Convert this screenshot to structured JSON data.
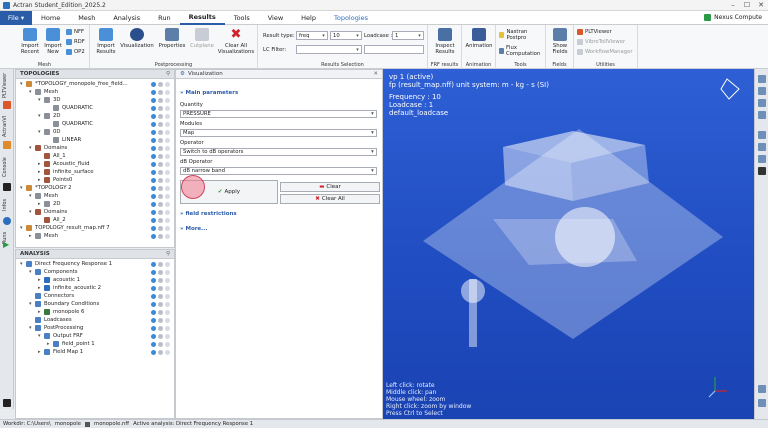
{
  "window": {
    "title": "Actran Student_Edition_2025.2"
  },
  "menu": {
    "file": "File",
    "items": [
      "Home",
      "Mesh",
      "Analysis",
      "Run",
      "Results",
      "Tools",
      "View",
      "Help",
      "Topologies"
    ],
    "active": "Results",
    "nexus": "Nexus Compute"
  },
  "ribbon": {
    "mesh": {
      "label": "Mesh",
      "import_recent": "Import Recent",
      "import_new": "Import New",
      "nff": "NFF",
      "rdf": "RDF",
      "op2": "OP2"
    },
    "postprocessing": {
      "label": "Postprocessing",
      "import_results": "Import Results",
      "visualization": "Visualization",
      "properties": "Properties",
      "cutplane": "Cutplane",
      "clear_all": "Clear All Visualizations"
    },
    "results_selection": {
      "label": "Results Selection",
      "result_type_label": "Result type:",
      "result_type": "freq",
      "count": "10",
      "loadcase_label": "Loadcase :",
      "loadcase": "1",
      "lc_filter_label": "LC Filter:"
    },
    "frf": {
      "label": "FRF results",
      "inspect": "Inspect Results"
    },
    "animation": {
      "label": "Animation",
      "button": "Animation"
    },
    "tools": {
      "label": "Tools",
      "nastran": "Nastran Postpro",
      "flux": "Flux Computation"
    },
    "fields": {
      "label": "Fields",
      "show": "Show Fields"
    },
    "utilities": {
      "label": "Utilities",
      "pltviewer": "PLTViewer",
      "vtv": "VibroTollViewer",
      "wfm": "WorkflowManager"
    }
  },
  "left_strip": {
    "tabs": [
      "PLTViewer",
      "ActranVI",
      "Console",
      "Infos",
      "Runs"
    ]
  },
  "topologies": {
    "header": "TOPOLOGIES",
    "rows": [
      {
        "label": "*TOPOLOGY_monopole_free_field...",
        "indent": 0,
        "tw": "▾",
        "color": "#c98a3a"
      },
      {
        "label": "Mesh",
        "indent": 1,
        "tw": "▾",
        "color": "#8a8f99"
      },
      {
        "label": "3D",
        "indent": 2,
        "tw": "▾",
        "color": "#8a8f99"
      },
      {
        "label": "QUADRATIC",
        "indent": 3,
        "tw": "",
        "color": "#8a8f99"
      },
      {
        "label": "2D",
        "indent": 2,
        "tw": "▾",
        "color": "#8a8f99"
      },
      {
        "label": "QUADRATIC",
        "indent": 3,
        "tw": "",
        "color": "#8a8f99"
      },
      {
        "label": "0D",
        "indent": 2,
        "tw": "▾",
        "color": "#8a8f99"
      },
      {
        "label": "LINEAR",
        "indent": 3,
        "tw": "",
        "color": "#8a8f99"
      },
      {
        "label": "Domains",
        "indent": 1,
        "tw": "▾",
        "color": "#a0553c"
      },
      {
        "label": "All_1",
        "indent": 2,
        "tw": "",
        "color": "#a0553c"
      },
      {
        "label": "Acoustic_fluid",
        "indent": 2,
        "tw": "▸",
        "color": "#a0553c"
      },
      {
        "label": "infinite_surface",
        "indent": 2,
        "tw": "▸",
        "color": "#a0553c"
      },
      {
        "label": "Points0",
        "indent": 2,
        "tw": "▸",
        "color": "#a0553c"
      },
      {
        "label": "*TOPOLOGY 2",
        "indent": 0,
        "tw": "▾",
        "color": "#c98a3a"
      },
      {
        "label": "Mesh",
        "indent": 1,
        "tw": "▾",
        "color": "#8a8f99"
      },
      {
        "label": "2D",
        "indent": 2,
        "tw": "▸",
        "color": "#8a8f99"
      },
      {
        "label": "Domains",
        "indent": 1,
        "tw": "▾",
        "color": "#a0553c"
      },
      {
        "label": "All_2",
        "indent": 2,
        "tw": "",
        "color": "#a0553c"
      },
      {
        "label": "TOPOLOGY_result_map.nff 7",
        "indent": 0,
        "tw": "▾",
        "color": "#c98a3a"
      },
      {
        "label": "Mesh",
        "indent": 1,
        "tw": "▸",
        "color": "#8a8f99"
      }
    ]
  },
  "analysis": {
    "header": "ANALYSIS",
    "rows": [
      {
        "label": "Direct Frequency Response 1",
        "indent": 0,
        "tw": "▾",
        "color": "#4b7fc4"
      },
      {
        "label": "Components",
        "indent": 1,
        "tw": "▾",
        "color": "#4b7fc4"
      },
      {
        "label": "acoustic 1",
        "indent": 2,
        "tw": "▸",
        "color": "#2a6ebd"
      },
      {
        "label": "infinite_acoustic 2",
        "indent": 2,
        "tw": "▸",
        "color": "#2a6ebd"
      },
      {
        "label": "Connectors",
        "indent": 1,
        "tw": "",
        "color": "#4b7fc4"
      },
      {
        "label": "Boundary Conditions",
        "indent": 1,
        "tw": "▾",
        "color": "#4b7fc4"
      },
      {
        "label": "monopole 6",
        "indent": 2,
        "tw": "▸",
        "color": "#3a7a3a"
      },
      {
        "label": "Loadcases",
        "indent": 1,
        "tw": "",
        "color": "#4b7fc4"
      },
      {
        "label": "PostProcessing",
        "indent": 1,
        "tw": "▾",
        "color": "#4b7fc4"
      },
      {
        "label": "Output FRF",
        "indent": 2,
        "tw": "▾",
        "color": "#4b7fc4"
      },
      {
        "label": "field_point 1",
        "indent": 3,
        "tw": "▸",
        "color": "#4b7fc4"
      },
      {
        "label": "Field Map 1",
        "indent": 2,
        "tw": "▸",
        "color": "#4b7fc4"
      }
    ]
  },
  "visualization": {
    "tab": "Visualization",
    "main_params": "Main parameters",
    "quantity_label": "Quantity",
    "quantity": "PRESSURE",
    "modules_label": "Modules",
    "modules": "Map",
    "operator_label": "Operator",
    "operator": "Switch to dB operators",
    "db_operator_label": "dB Operator",
    "db_operator": "dB narrow band",
    "apply": "Apply",
    "clear": "Clear",
    "clear_all": "Clear All",
    "field_restrictions": "field restrictions",
    "more": "More..."
  },
  "viewport": {
    "line1": "vp 1 (active)",
    "line2": "fp (result_map.nff) unit system: m - kg - s (SI)",
    "line3": "Frequency : 10",
    "line4": "Loadcase : 1",
    "line5": "default_loadcase",
    "help": [
      "Left click: rotate",
      "Middle click: pan",
      "Mouse wheel: zoom",
      "Right click: zoom by window",
      "Press Ctrl to Select"
    ]
  },
  "status": {
    "workdir": "Workdir: C:\\Users\\",
    "item1": "monopole",
    "item2": "monopole.nff",
    "active": "Active analysis: Direct Frequency Response 1"
  }
}
